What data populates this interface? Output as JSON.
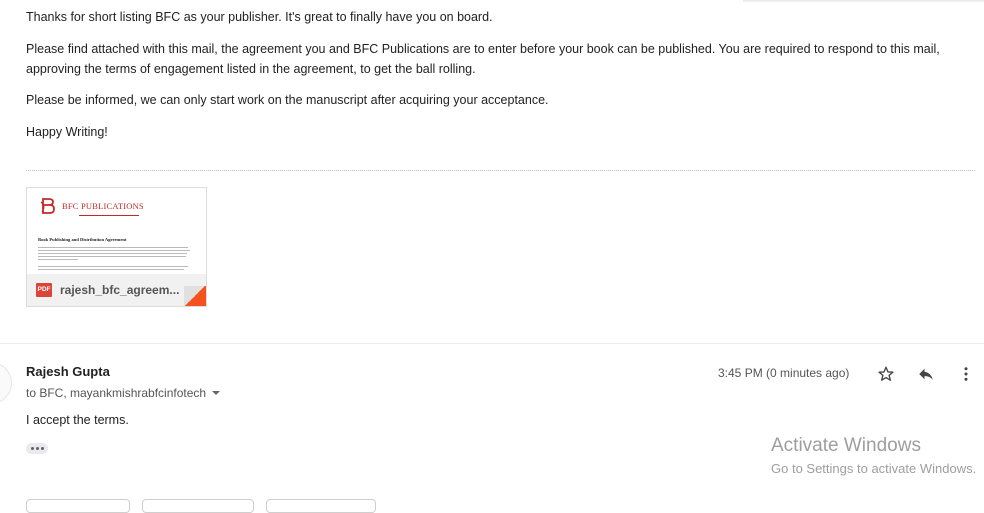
{
  "message1": {
    "paragraphs": [
      "Thanks for short listing BFC as your publisher. It's great to finally have you on board.",
      "Please find attached with this mail, the agreement you and BFC Publications are to enter before your book can be published. You are required to respond to this mail, approving the terms of engagement listed in the agreement, to get the ball rolling.",
      "Please be informed, we can only start work on the manuscript after acquiring your acceptance.",
      "Happy Writing!"
    ],
    "attachment": {
      "filename": "rajesh_bfc_agreem...",
      "file_type": "PDF",
      "preview_brand": "BFC PUBLICATIONS",
      "preview_title": "Book Publishing and Distribution Agreement"
    }
  },
  "message2": {
    "sender": "Rajesh Gupta",
    "recipients": "to BFC, mayankmishrabfcinfotech",
    "time": "3:45 PM (0 minutes ago)",
    "body": "I accept the terms."
  },
  "watermark": {
    "title": "Activate Windows",
    "subtitle": "Go to Settings to activate Windows."
  },
  "colors": {
    "brand_red": "#c62828",
    "pdf_red": "#db4437",
    "corner_orange": "#f4511e"
  },
  "icons": [
    "star-icon",
    "reply-icon",
    "more-vert-icon",
    "dropdown-caret-icon",
    "pdf-icon",
    "ellipsis-icon"
  ]
}
